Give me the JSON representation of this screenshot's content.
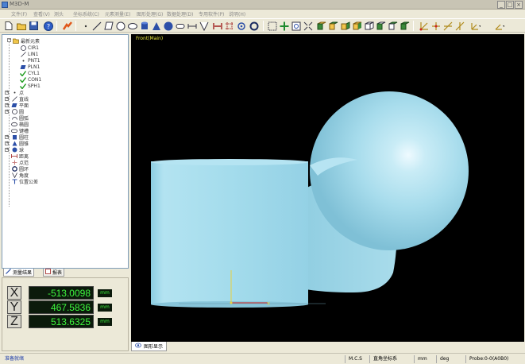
{
  "window": {
    "title": "M3D-M",
    "minimize": "_",
    "maximize": "□",
    "close": "×"
  },
  "menu": [
    "文件(F)",
    "查看(V)",
    "测头",
    "坐标系统(C)",
    "元素测量(E)",
    "图形处理(G)",
    "数据处理(D)",
    "专用软件(P)",
    "说明(H)"
  ],
  "tree": {
    "root": "最新元素",
    "children": [
      "CIR1",
      "LIN1",
      "PNT1",
      "PLN1",
      "CYL1",
      "CON1",
      "SPH1"
    ],
    "categories": [
      "点",
      "直线",
      "平面",
      "圆",
      "圆弧",
      "椭圆",
      "键槽",
      "圆柱",
      "圆锥",
      "球",
      "距离",
      "点范",
      "圆环",
      "角度",
      "位置公差"
    ]
  },
  "tree_tabs": [
    "测量结果",
    "报表"
  ],
  "coords": {
    "x_label": "X",
    "x_value": "-513.0098",
    "x_unit": "mm",
    "y_label": "Y",
    "y_value": "467.5836",
    "y_unit": "mm",
    "z_label": "Z",
    "z_value": "513.6325",
    "z_unit": "mm"
  },
  "view": {
    "label": "Front(Main)",
    "tab": "图形显示",
    "shape_color": "#a7dcec",
    "background": "#000000"
  },
  "status": {
    "ready": "准备就绪",
    "mcs": "M.C.S",
    "coord_system": "直角坐标系",
    "length_unit": "mm",
    "angle_unit": "deg",
    "probe": "Probe:0-0(A0B0)"
  }
}
